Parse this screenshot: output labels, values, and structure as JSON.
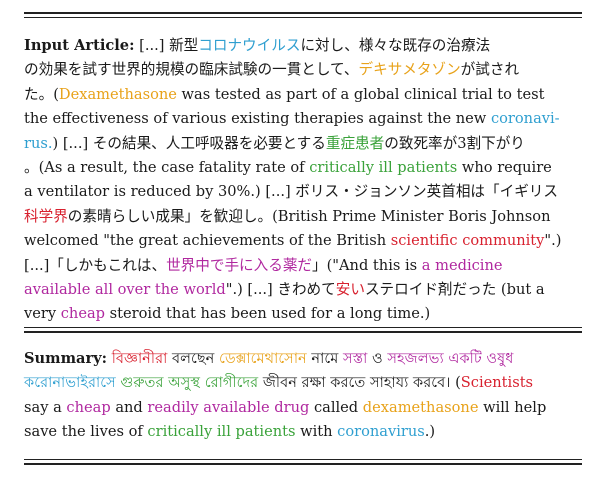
{
  "labels": {
    "input": "Input Article:",
    "summary": "Summary:"
  },
  "colors": {
    "blue": "#2f9fd0",
    "orange": "#e8a21a",
    "green": "#3aa23a",
    "red": "#d8212f",
    "purple": "#b0289f"
  },
  "article": {
    "lines": [
      [
        {
          "t": " [...] 新型"
        },
        {
          "t": "コロナウイルス",
          "c": "blue"
        },
        {
          "t": "に対し、様々な既存の治療法"
        }
      ],
      [
        {
          "t": "の効果を試す世界的規模の臨床試験の一貫として、"
        },
        {
          "t": "デキサメタゾン",
          "c": "orange"
        },
        {
          "t": "が試され"
        }
      ],
      [
        {
          "t": "た。("
        },
        {
          "t": "Dexamethasone",
          "c": "orange"
        },
        {
          "t": " was tested as part of a global clinical trial to test"
        }
      ],
      [
        {
          "t": "the effectiveness of various existing therapies against the new "
        },
        {
          "t": "coronavi-",
          "c": "blue"
        }
      ],
      [
        {
          "t": "rus.",
          "c": "blue"
        },
        {
          "t": ") [...] その結果、人工呼吸器を必要とする"
        },
        {
          "t": "重症患者",
          "c": "green"
        },
        {
          "t": "の致死率が3割下がり"
        }
      ],
      [
        {
          "t": "。(As a result, the case fatality rate of "
        },
        {
          "t": "critically ill patients",
          "c": "green"
        },
        {
          "t": " who require"
        }
      ],
      [
        {
          "t": "a ventilator is reduced by 30%.) [...] ボリス・ジョンソン英首相は「イギリス"
        }
      ],
      [
        {
          "t": "科学界",
          "c": "red"
        },
        {
          "t": "の素晴らしい成果」を歓迎し。(British Prime Minister Boris Johnson"
        }
      ],
      [
        {
          "t": "welcomed \"the great achievements of the British "
        },
        {
          "t": "scientific community",
          "c": "red"
        },
        {
          "t": "\".)"
        }
      ],
      [
        {
          "t": "[...]「しかもこれは、"
        },
        {
          "t": "世界中で手に入る薬だ",
          "c": "purple"
        },
        {
          "t": "」(\"And this is "
        },
        {
          "t": "a medicine",
          "c": "purple"
        }
      ],
      [
        {
          "t": "available all over the world",
          "c": "purple"
        },
        {
          "t": "\".) [...] きわめて"
        },
        {
          "t": "安い",
          "c": "red"
        },
        {
          "t": "ステロイド剤だった (but a"
        }
      ],
      [
        {
          "t": "very "
        },
        {
          "t": "cheap",
          "c": "purple"
        },
        {
          "t": " steroid that has been used for a long time.)"
        }
      ]
    ]
  },
  "summary": {
    "lines": [
      [
        {
          "t": " "
        },
        {
          "t": "বিজ্ঞানীরা",
          "c": "red"
        },
        {
          "t": " বলছেন "
        },
        {
          "t": "ডেক্সামেথাসোন",
          "c": "orange"
        },
        {
          "t": " নামে "
        },
        {
          "t": "সস্তা",
          "c": "purple"
        },
        {
          "t": " ও "
        },
        {
          "t": "সহজলভ্য একটি ওষুধ",
          "c": "purple"
        }
      ],
      [
        {
          "t": "করোনাভাইরাসে",
          "c": "blue"
        },
        {
          "t": " গুরুতর অসুস্থ রোগীদের",
          "c": "green"
        },
        {
          "t": " জীবন রক্ষা করতে সাহায্য করবে। ("
        },
        {
          "t": "Scientists",
          "c": "red"
        }
      ],
      [
        {
          "t": "say a "
        },
        {
          "t": "cheap",
          "c": "purple"
        },
        {
          "t": " and "
        },
        {
          "t": "readily available drug",
          "c": "purple"
        },
        {
          "t": " called "
        },
        {
          "t": "dexamethasone",
          "c": "orange"
        },
        {
          "t": " will help"
        }
      ],
      [
        {
          "t": "save the lives of "
        },
        {
          "t": "critically ill patients",
          "c": "green"
        },
        {
          "t": " with "
        },
        {
          "t": "coronavirus",
          "c": "blue"
        },
        {
          "t": ".)"
        }
      ]
    ]
  }
}
